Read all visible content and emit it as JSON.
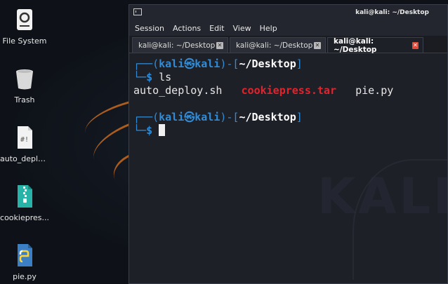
{
  "desktop": {
    "icons": [
      {
        "label": "File System",
        "icon": "drive-icon"
      },
      {
        "label": "Trash",
        "icon": "trash-icon"
      },
      {
        "label": "auto_deplo...",
        "icon": "script-file-icon"
      },
      {
        "label": "cookiepres...",
        "icon": "archive-file-icon"
      },
      {
        "label": "pie.py",
        "icon": "python-file-icon"
      }
    ],
    "watermark": "KALI"
  },
  "terminal": {
    "title": "kali@kali: ~/Desktop",
    "menu": [
      "Session",
      "Actions",
      "Edit",
      "View",
      "Help"
    ],
    "tabs": [
      {
        "label": "kali@kali: ~/Desktop",
        "active": false
      },
      {
        "label": "kali@kali: ~/Desktop",
        "active": false
      },
      {
        "label": "kali@kali: ~/Desktop",
        "active": true
      }
    ],
    "prompt": {
      "open": "┌──(",
      "user": "kali㉿kali",
      "mid": ")-[",
      "path": "~/Desktop",
      "close": "]",
      "branch": "└─",
      "dollar": "$"
    },
    "command": "ls",
    "ls_output": [
      "auto_deploy.sh",
      "cookiepress.tar",
      "pie.py"
    ],
    "colors": {
      "prompt": "#2f8cd8",
      "archive": "#e0242d",
      "background": "#1e2028"
    }
  }
}
